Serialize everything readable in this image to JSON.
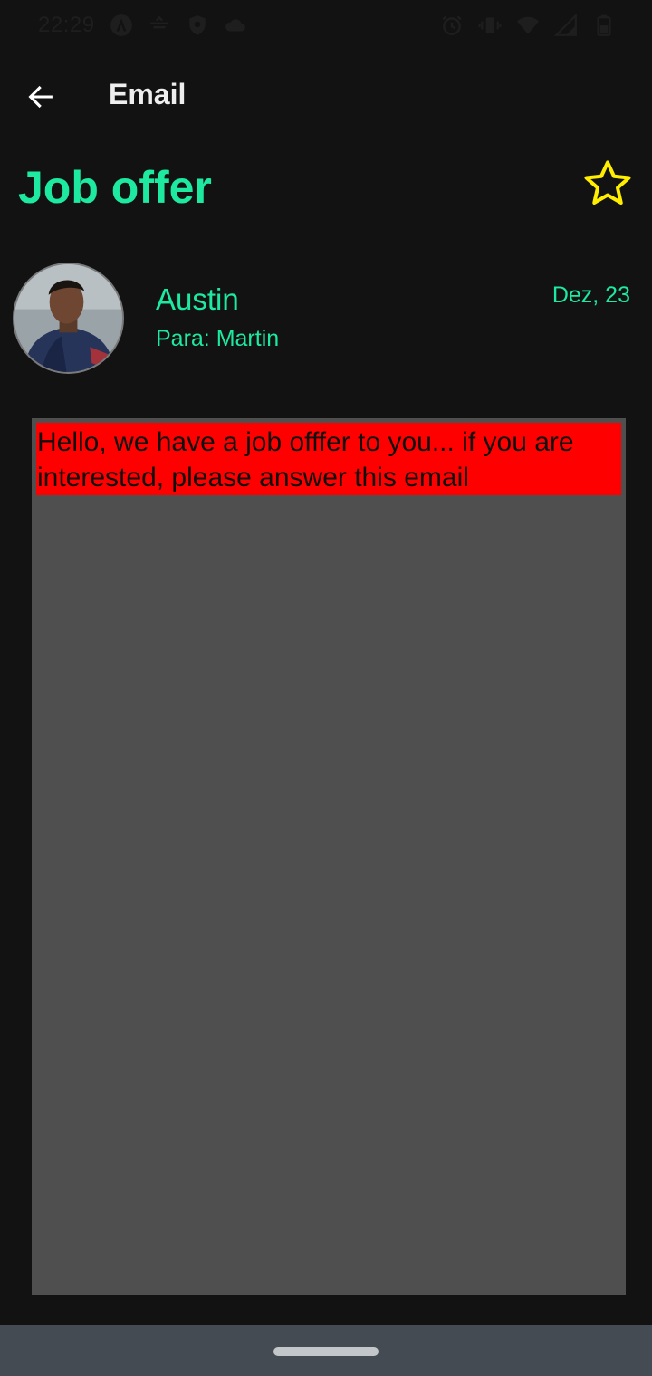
{
  "status_bar": {
    "time": "22:29",
    "left_icons": [
      "android-icon",
      "debug-icon",
      "shield-icon",
      "cloud-icon"
    ],
    "right_icons": [
      "alarm-icon",
      "vibrate-icon",
      "wifi-icon",
      "signal-icon",
      "battery-icon"
    ]
  },
  "app_bar": {
    "back_icon": "arrow-left-icon",
    "title": "Email"
  },
  "email": {
    "subject": "Job offer",
    "starred": false,
    "sender": "Austin",
    "recipient": "Para: Martin",
    "date": "Dez, 23",
    "body": "Hello, we have a job offfer to you... if you are interested, please answer this email"
  },
  "colors": {
    "accent": "#1de9a0",
    "star": "#ffee00",
    "background": "#121212",
    "body_box": "#4f4f4f",
    "body_highlight": "#ff0000",
    "nav_bar": "#454b52"
  }
}
